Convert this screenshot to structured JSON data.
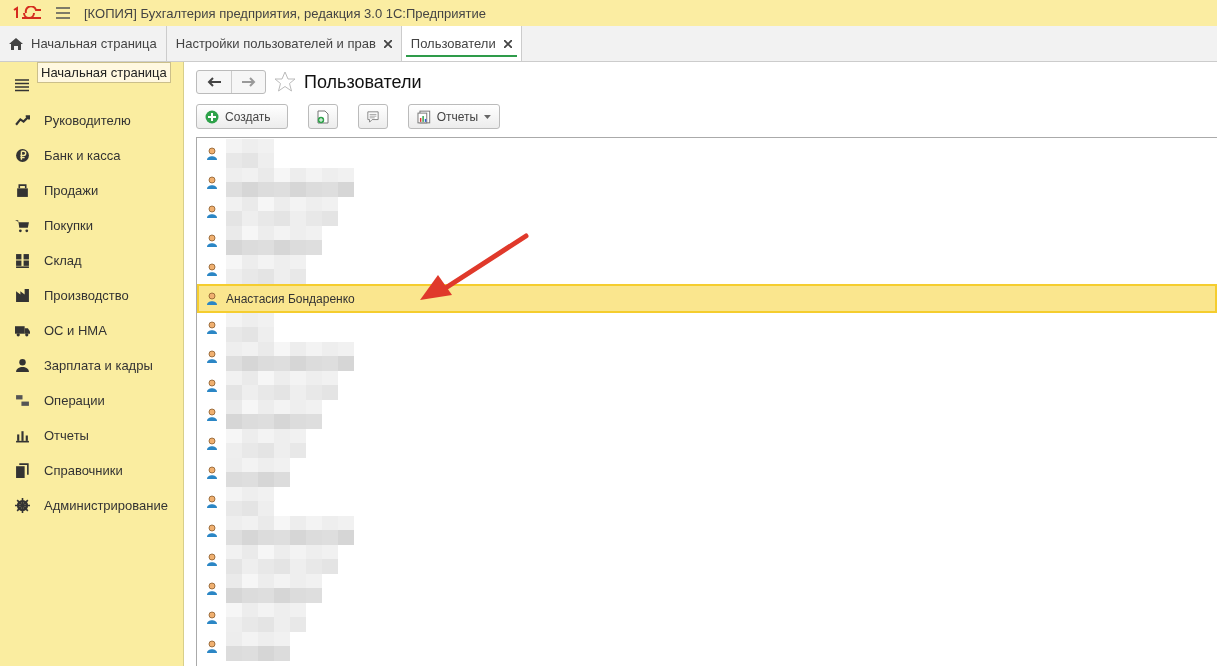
{
  "window": {
    "title": "[КОПИЯ] Бухгалтерия предприятия, редакция 3.0 1С:Предприятие"
  },
  "tabs": [
    {
      "label": "Начальная страница",
      "kind": "home",
      "selected": false
    },
    {
      "label": "Настройки пользователей и прав",
      "kind": "closable",
      "selected": false
    },
    {
      "label": "Пользователи",
      "kind": "closable",
      "selected": true
    }
  ],
  "tooltip": "Начальная страница",
  "sidebar": {
    "items": [
      {
        "label": "Руководителю"
      },
      {
        "label": "Банк и касса"
      },
      {
        "label": "Продажи"
      },
      {
        "label": "Покупки"
      },
      {
        "label": "Склад"
      },
      {
        "label": "Производство"
      },
      {
        "label": "ОС и НМА"
      },
      {
        "label": "Зарплата и кадры"
      },
      {
        "label": "Операции"
      },
      {
        "label": "Отчеты"
      },
      {
        "label": "Справочники"
      },
      {
        "label": "Администрирование"
      }
    ]
  },
  "form": {
    "title": "Пользователи",
    "favorite": false
  },
  "toolbar": {
    "create": "Создать",
    "reports": "Отчеты"
  },
  "rows": [
    {
      "kind": "redacted",
      "selected": false
    },
    {
      "kind": "redacted",
      "selected": false
    },
    {
      "kind": "redacted",
      "selected": false
    },
    {
      "kind": "redacted",
      "selected": false
    },
    {
      "kind": "redacted",
      "selected": false
    },
    {
      "kind": "name",
      "name": "Анастасия Бондаренко",
      "selected": true
    },
    {
      "kind": "redacted",
      "selected": false
    },
    {
      "kind": "redacted",
      "selected": false
    },
    {
      "kind": "redacted",
      "selected": false
    },
    {
      "kind": "redacted",
      "selected": false
    },
    {
      "kind": "redacted",
      "selected": false
    },
    {
      "kind": "redacted",
      "selected": false
    },
    {
      "kind": "redacted",
      "selected": false
    },
    {
      "kind": "redacted",
      "selected": false
    },
    {
      "kind": "redacted",
      "selected": false
    },
    {
      "kind": "redacted",
      "selected": false
    },
    {
      "kind": "redacted",
      "selected": false
    },
    {
      "kind": "redacted",
      "selected": false
    }
  ]
}
